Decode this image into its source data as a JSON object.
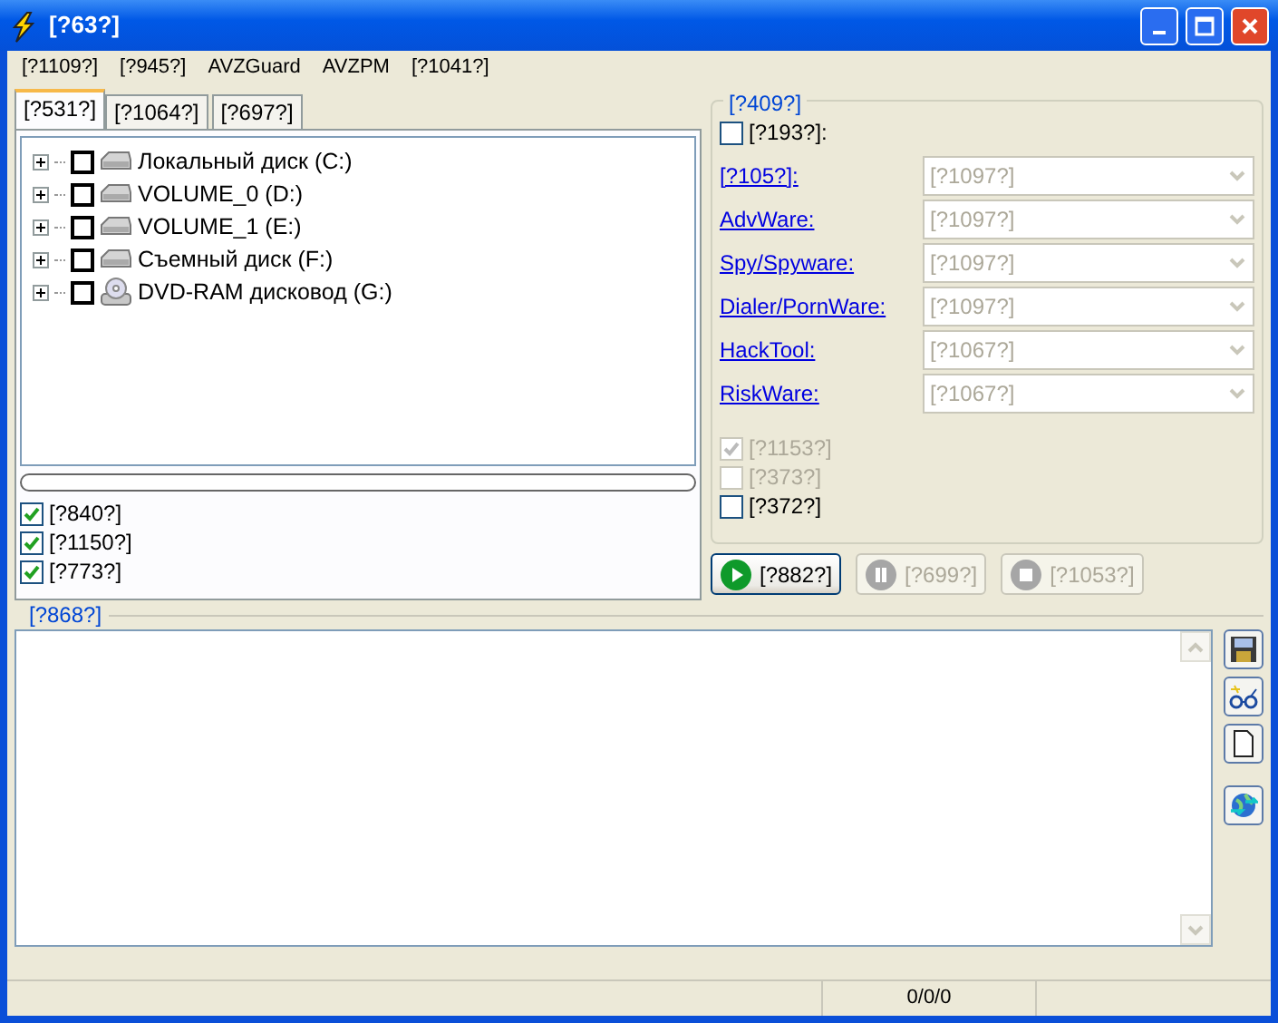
{
  "window": {
    "title": "[?63?]"
  },
  "menu": [
    "[?1109?]",
    "[?945?]",
    "AVZGuard",
    "AVZPM",
    "[?1041?]"
  ],
  "tabs": [
    {
      "label": "[?531?]",
      "selected": true
    },
    {
      "label": "[?1064?]",
      "selected": false
    },
    {
      "label": "[?697?]",
      "selected": false
    }
  ],
  "drives": [
    {
      "label": "Локальный диск (C:)",
      "kind": "hdd",
      "checked": false,
      "expanded": false
    },
    {
      "label": "VOLUME_0 (D:)",
      "kind": "hdd",
      "checked": false,
      "expanded": false
    },
    {
      "label": "VOLUME_1 (E:)",
      "kind": "hdd",
      "checked": false,
      "expanded": false
    },
    {
      "label": "Съемный диск (F:)",
      "kind": "hdd",
      "checked": false,
      "expanded": false
    },
    {
      "label": "DVD-RAM дисковод (G:)",
      "kind": "dvd",
      "checked": false,
      "expanded": false
    }
  ],
  "progress": {
    "level": 0
  },
  "options": [
    {
      "label": "[?840?]",
      "checked": true
    },
    {
      "label": "[?1150?]",
      "checked": true
    },
    {
      "label": "[?773?]",
      "checked": true
    }
  ],
  "group": {
    "title": "[?409?]",
    "enable": {
      "label": "[?193?]:",
      "checked": false
    },
    "categories": [
      {
        "label": "[?105?]:",
        "value": "[?1097?]",
        "disabled": true
      },
      {
        "label": "AdvWare:",
        "value": "[?1097?]",
        "disabled": true
      },
      {
        "label": "Spy/Spyware:",
        "value": "[?1097?]",
        "disabled": true
      },
      {
        "label": "Dialer/PornWare:",
        "value": "[?1097?]",
        "disabled": true
      },
      {
        "label": "HackTool:",
        "value": "[?1067?]",
        "disabled": true
      },
      {
        "label": "RiskWare:",
        "value": "[?1067?]",
        "disabled": true
      }
    ],
    "checks": [
      {
        "label": "[?1153?]",
        "checked": true,
        "disabled": true
      },
      {
        "label": "[?373?]",
        "checked": false,
        "disabled": true
      },
      {
        "label": "[?372?]",
        "checked": false,
        "disabled": false
      }
    ]
  },
  "actions": [
    {
      "label": "[?882?]",
      "kind": "play",
      "disabled": false
    },
    {
      "label": "[?699?]",
      "kind": "pause",
      "disabled": true
    },
    {
      "label": "[?1053?]",
      "kind": "stop",
      "disabled": true
    }
  ],
  "log": {
    "title": "[?868?]"
  },
  "side_buttons": [
    {
      "kind": "save"
    },
    {
      "kind": "glasses"
    },
    {
      "kind": "new"
    },
    {
      "kind": "globe"
    }
  ],
  "status_bar": {
    "counts": "0/0/0"
  }
}
